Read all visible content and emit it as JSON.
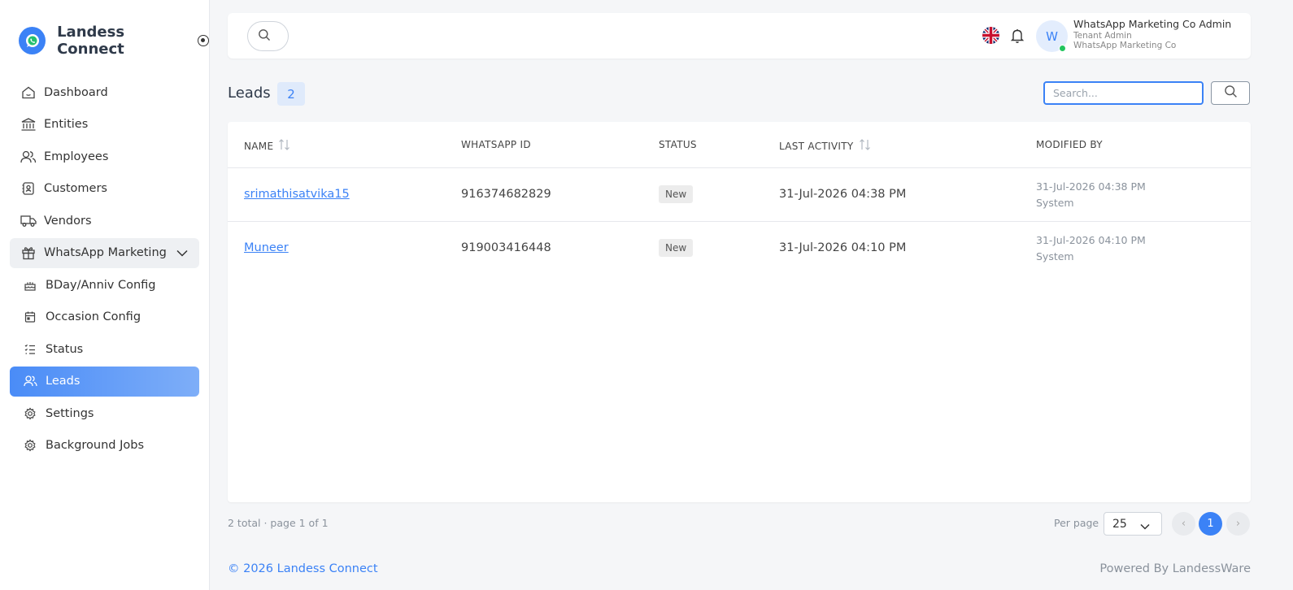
{
  "brand": {
    "name": "Landess Connect"
  },
  "sidebar": {
    "items": [
      {
        "label": "Dashboard"
      },
      {
        "label": "Entities"
      },
      {
        "label": "Employees"
      },
      {
        "label": "Customers"
      },
      {
        "label": "Vendors"
      },
      {
        "label": "WhatsApp Marketing"
      },
      {
        "label": "BDay/Anniv Config"
      },
      {
        "label": "Occasion Config"
      },
      {
        "label": "Status"
      },
      {
        "label": "Leads"
      },
      {
        "label": "Settings"
      },
      {
        "label": "Background Jobs"
      }
    ]
  },
  "topbar": {
    "avatar_initial": "W",
    "user_name": "WhatsApp Marketing Co Admin",
    "user_role": "Tenant Admin",
    "user_org": "WhatsApp Marketing Co"
  },
  "page": {
    "title": "Leads",
    "count": "2",
    "search_placeholder": "Search..."
  },
  "table": {
    "headers": {
      "name": "NAME",
      "whatsapp_id": "WHATSAPP ID",
      "status": "STATUS",
      "last_activity": "LAST ACTIVITY",
      "modified_by": "MODIFIED BY"
    },
    "rows": [
      {
        "name": "srimathisatvika15",
        "whatsapp_id": "916374682829",
        "status": "New",
        "last_activity": "31-Jul-2026 04:38 PM",
        "modified_date": "31-Jul-2026 04:38 PM",
        "modified_user": "System"
      },
      {
        "name": "Muneer",
        "whatsapp_id": "919003416448",
        "status": "New",
        "last_activity": "31-Jul-2026 04:10 PM",
        "modified_date": "31-Jul-2026 04:10 PM",
        "modified_user": "System"
      }
    ]
  },
  "pagination": {
    "summary": "2 total · page 1 of 1",
    "per_page_label": "Per page",
    "per_page_value": "25",
    "prev": "‹",
    "current": "1",
    "next": "›"
  },
  "footer": {
    "copyright": "© 2026 Landess Connect",
    "powered": "Powered By LandessWare"
  },
  "colors": {
    "accent": "#3b82f6",
    "online": "#22c55e"
  }
}
